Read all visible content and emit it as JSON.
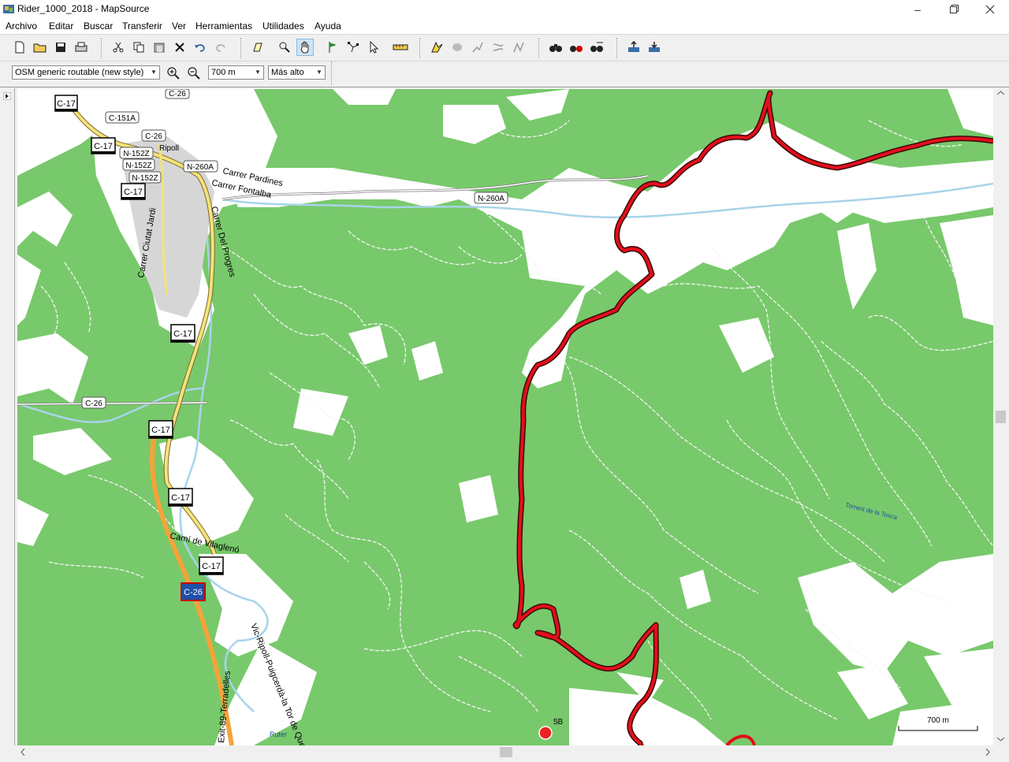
{
  "window": {
    "title": "Rider_1000_2018 - MapSource"
  },
  "menu": [
    "Archivo",
    "Editar",
    "Buscar",
    "Transferir",
    "Ver",
    "Herramientas",
    "Utilidades",
    "Ayuda"
  ],
  "toolbar": {
    "map_product": "OSM generic routable (new style)",
    "zoom_level": "700 m",
    "detail_level": "Más alto"
  },
  "map": {
    "road_labels": [
      "C-17",
      "C-151A",
      "C-26",
      "N-152Z",
      "N-260A",
      "C-26",
      "C-17",
      "C-17",
      "C-17",
      "C-17",
      "C-17",
      "C-26",
      "C-17",
      "N-152Z",
      "N-152Z",
      "C-26",
      "N-260A"
    ],
    "street_labels": [
      "Carrer Pardines",
      "Carrer Fontalba",
      "Carrer Del Progres",
      "Carrer Ciutat Jardi",
      "Camí de Vilaglenó",
      "Vic-Ripoll-Puigcerdà-la Tor de Querol",
      "Exit-89-Terradelles",
      "Ripoll",
      "Ruter",
      "Torrent de la Tosca"
    ],
    "waypoint": "5B",
    "scale": "700 m"
  },
  "colors": {
    "forest": "#78c96b",
    "track": "#e20f1a",
    "road_yellow": "#f4e27a",
    "motorway": "#f5a33a",
    "water": "#a8d4ea"
  }
}
